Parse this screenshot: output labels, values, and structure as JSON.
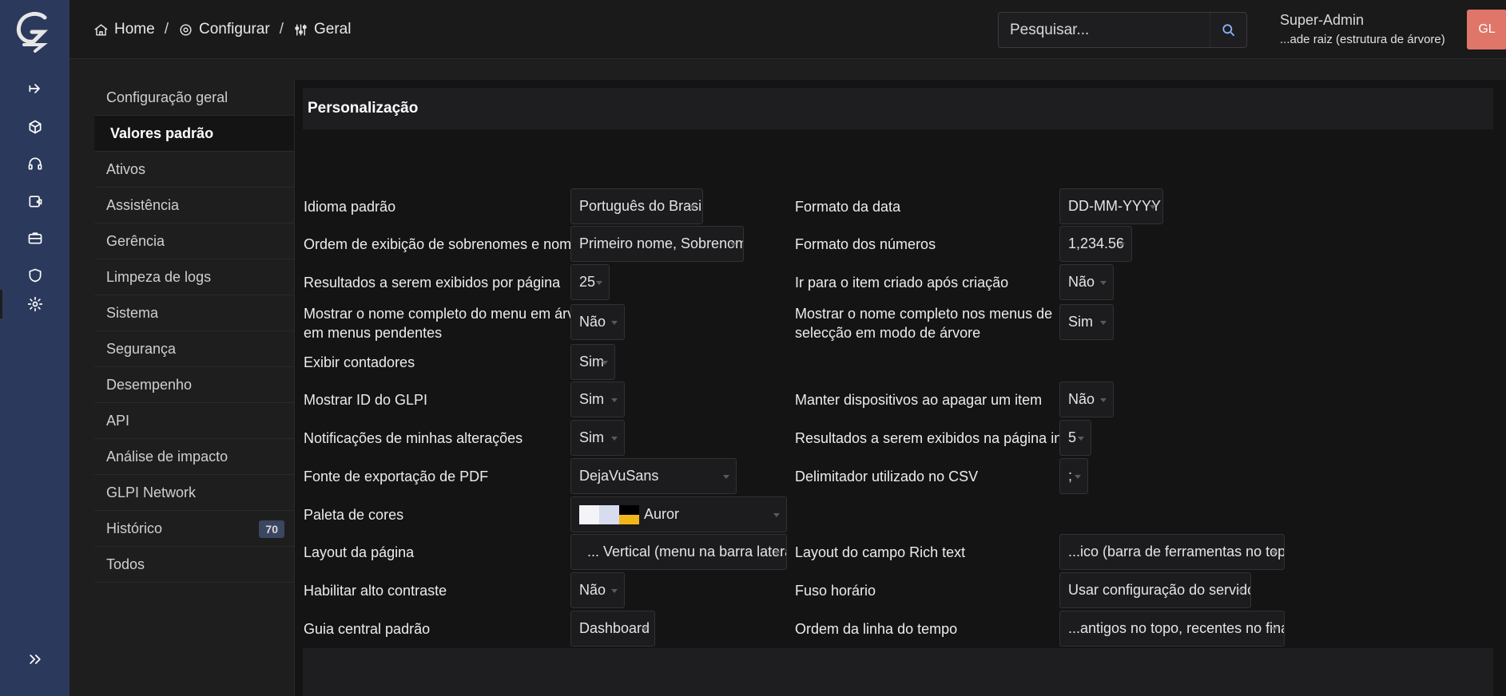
{
  "app": {
    "logo_text": "G"
  },
  "colors": {
    "sidebar": "#2b3a5c",
    "avatar": "#e0756a",
    "accent": "#8ab4f8"
  },
  "sidebar": {
    "icons": [
      "arrow-right-to-bracket-icon",
      "cube-icon",
      "headset-icon",
      "wallet-icon",
      "briefcase-icon",
      "shield-icon",
      "gear-icon",
      "collapse-chevrons-icon"
    ]
  },
  "breadcrumb": {
    "home": "Home",
    "configure": "Configurar",
    "general": "Geral",
    "separator": "/"
  },
  "search": {
    "placeholder": "Pesquisar..."
  },
  "user": {
    "name": "Super-Admin",
    "entity": "...ade raiz (estrutura de árvore)",
    "initials": "GL"
  },
  "tabs": [
    {
      "label": "Configuração geral"
    },
    {
      "label": "Valores padrão"
    },
    {
      "label": "Ativos"
    },
    {
      "label": "Assistência"
    },
    {
      "label": "Gerência"
    },
    {
      "label": "Limpeza de logs"
    },
    {
      "label": "Sistema"
    },
    {
      "label": "Segurança"
    },
    {
      "label": "Desempenho"
    },
    {
      "label": "API"
    },
    {
      "label": "Análise de impacto"
    },
    {
      "label": "GLPI Network"
    },
    {
      "label": "Histórico",
      "badge": "70"
    },
    {
      "label": "Todos"
    }
  ],
  "panel": {
    "title": "Personalização",
    "fields": {
      "language": {
        "label": "Idioma padrão",
        "value": "Português do Brasil"
      },
      "date_format": {
        "label": "Formato da data",
        "value": "DD-MM-YYYY"
      },
      "name_order": {
        "label": "Ordem de exibição de sobrenomes e nomes",
        "value": "Primeiro nome, Sobrenome"
      },
      "number_format": {
        "label": "Formato dos números",
        "value": "1,234.56"
      },
      "results_per_page": {
        "label": "Resultados a serem exibidos por página",
        "value": "25"
      },
      "goto_created": {
        "label": "Ir para o item criado após criação",
        "value": "Não"
      },
      "full_menu_tree": {
        "label_1": "Mostrar o nome completo do menu em árvore",
        "label_2": "em menus pendentes",
        "value": "Não"
      },
      "full_name_tree": {
        "label_1": "Mostrar o nome completo nos menus de",
        "label_2": "selecção em modo de árvore",
        "value": "Sim"
      },
      "counters": {
        "label": "Exibir contadores",
        "value": "Sim"
      },
      "show_id": {
        "label": "Mostrar ID do GLPI",
        "value": "Sim"
      },
      "keep_devices": {
        "label": "Manter dispositivos ao apagar um item",
        "value": "Não"
      },
      "notifications": {
        "label": "Notificações de minhas alterações",
        "value": "Sim"
      },
      "home_results": {
        "label": "Resultados a serem exibidos na página inicial",
        "value": "5"
      },
      "pdf_font": {
        "label": "Fonte de exportação de PDF",
        "value": "DejaVuSans"
      },
      "csv_delimiter": {
        "label": "Delimitador utilizado no CSV",
        "value": ";"
      },
      "palette": {
        "label": "Paleta de cores",
        "value": "Auror",
        "swatch": [
          "#f4f4f8",
          "#d8dcef",
          "#000000",
          "#f2b619"
        ]
      },
      "page_layout": {
        "label": "Layout da página",
        "value": "... Vertical (menu na barra lateral)"
      },
      "richtext_layout": {
        "label": "Layout do campo Rich text",
        "value": "...ico (barra de ferramentas no topo)"
      },
      "high_contrast": {
        "label": "Habilitar alto contraste",
        "value": "Não"
      },
      "timezone": {
        "label": "Fuso horário",
        "value": "Usar configuração do servidor"
      },
      "central_tab": {
        "label": "Guia central padrão",
        "value": "Dashboard"
      },
      "timeline_order": {
        "label": "Ordem da linha do tempo",
        "value": "...antigos no topo, recentes no final)"
      }
    }
  }
}
